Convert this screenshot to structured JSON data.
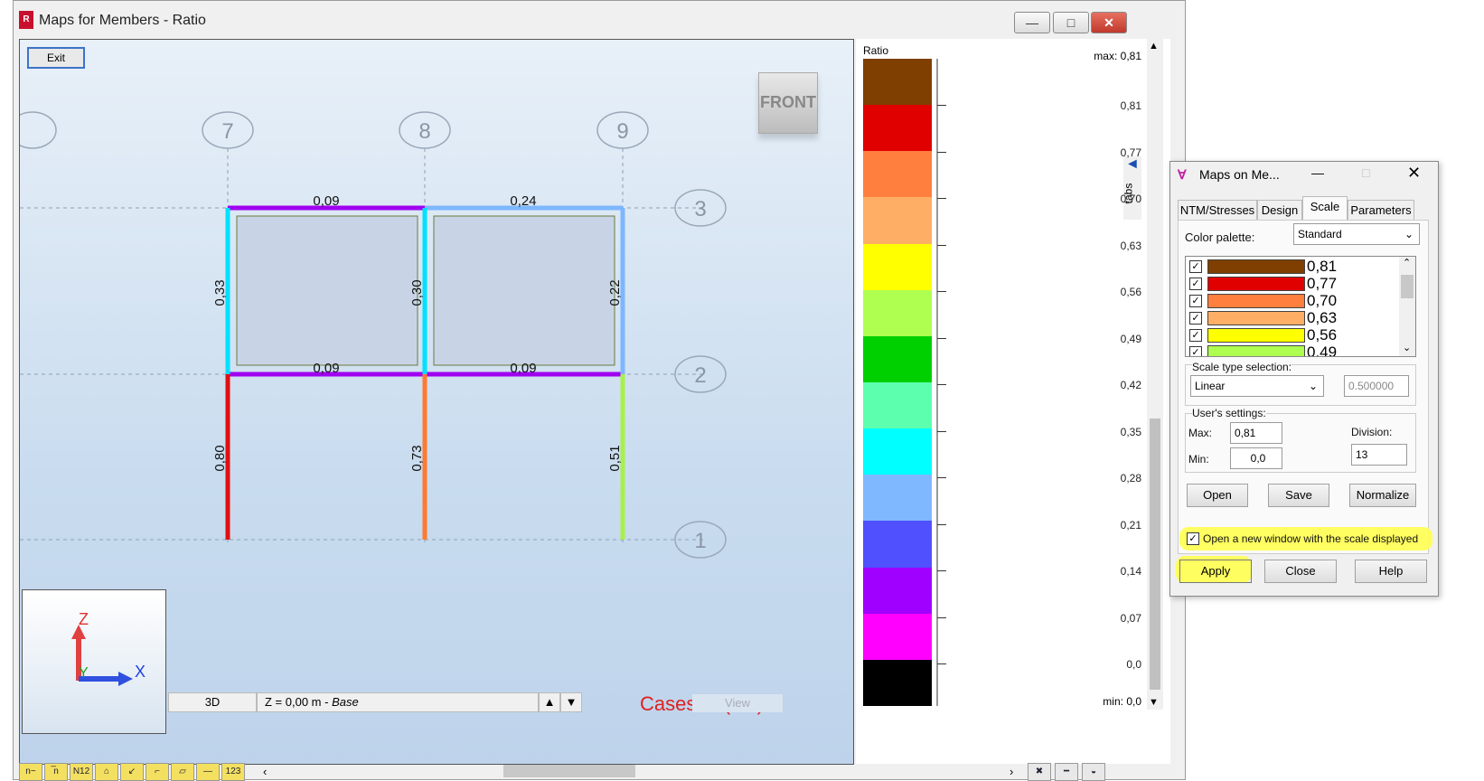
{
  "window": {
    "title": "Maps for Members - Ratio",
    "app_icon": "robot-app-icon",
    "controls": [
      "minimize-icon",
      "maximize-icon",
      "close-icon"
    ]
  },
  "viewport": {
    "exit_label": "Exit",
    "view_cube_label": "FRONT",
    "cases_label": "Cases: 1 (PP)",
    "axis_labels": {
      "z": "Z",
      "y": "Y",
      "x": "X"
    },
    "grid_labels": {
      "columns": [
        "7",
        "8",
        "9"
      ],
      "rows": [
        "3",
        "2",
        "1"
      ]
    },
    "member_values": {
      "beam_top_left": "0,09",
      "beam_top_right": "0,24",
      "beam_mid_left": "0,09",
      "beam_mid_right": "0,09",
      "col_upper_left": "0,33",
      "col_upper_mid": "0,30",
      "col_upper_right": "0,22",
      "col_lower_left": "0,80",
      "col_lower_mid": "0,73",
      "col_lower_right": "0,51"
    },
    "member_colors": {
      "purple": "#a000f0",
      "light_blue": "#7db7ff",
      "cyan": "#00e0ff",
      "red": "#e01010",
      "orange": "#ff7a30",
      "lime": "#a8f04a",
      "slab": "#c8d4e6"
    },
    "bottom": {
      "view_mode": "3D",
      "level_label": "Z = 0,00 m",
      "level_name": "Base",
      "view_label": "View"
    },
    "toolbar_icons": [
      "node-numbers-icon",
      "member-numbers-icon",
      "section-names-icon",
      "supports-icon",
      "loads-icon",
      "local-axes-icon",
      "panels-icon",
      "offsets-icon",
      "values-icon"
    ],
    "right_icons": [
      "structure-icon",
      "section-shape-icon",
      "display-icon"
    ]
  },
  "legend": {
    "title": "Ratio",
    "max_label": "max:",
    "min_label": "min:",
    "max_value": "0,81",
    "min_value": "0,0",
    "ticks": [
      "0,81",
      "0,77",
      "0,70",
      "0,63",
      "0,56",
      "0,49",
      "0,42",
      "0,35",
      "0,28",
      "0,21",
      "0,14",
      "0,07",
      "0,0"
    ],
    "colors": [
      "#7f3f00",
      "#e00000",
      "#ff7f3f",
      "#ffae66",
      "#ffff00",
      "#aeff50",
      "#00d000",
      "#5cffae",
      "#00ffff",
      "#80b8ff",
      "#5050ff",
      "#a000ff",
      "#ff00ff",
      "#000000"
    ],
    "tabs_label": "tabs"
  },
  "dialog": {
    "title": "Maps on Me...",
    "tabs": [
      "NTM/Stresses",
      "Design",
      "Scale",
      "Parameters"
    ],
    "active_tab": "Scale",
    "color_palette_label": "Color palette:",
    "color_palette_value": "Standard",
    "palette_rows": [
      {
        "color": "#7f3f00",
        "value": "0,81"
      },
      {
        "color": "#e00000",
        "value": "0,77"
      },
      {
        "color": "#ff7f3f",
        "value": "0,70"
      },
      {
        "color": "#ffae66",
        "value": "0,63"
      },
      {
        "color": "#ffff00",
        "value": "0,56"
      },
      {
        "color": "#aeff50",
        "value": "0,49"
      }
    ],
    "scale_type_label": "Scale type selection:",
    "scale_type_value": "Linear",
    "scale_param": "0.500000",
    "user_settings_label": "User's settings:",
    "max_label": "Max:",
    "max_value": "0,81",
    "min_label": "Min:",
    "min_value": "0,0",
    "division_label": "Division:",
    "division_value": "13",
    "open_label": "Open",
    "save_label": "Save",
    "normalize_label": "Normalize",
    "new_window_label": "Open a new window with the scale displayed",
    "apply_label": "Apply",
    "close_label": "Close",
    "help_label": "Help"
  }
}
